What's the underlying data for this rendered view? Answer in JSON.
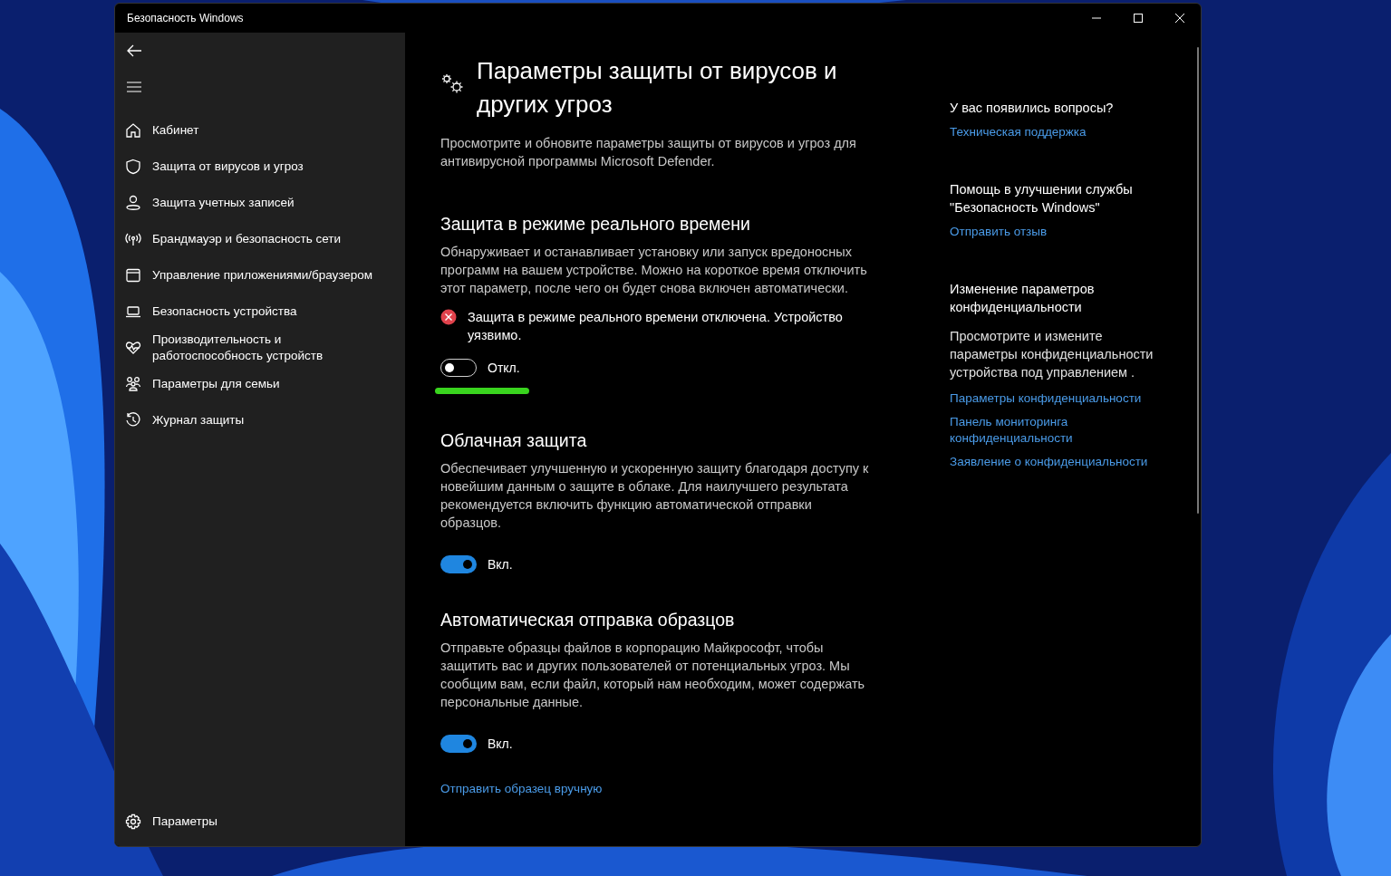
{
  "window": {
    "title": "Безопасность Windows"
  },
  "sidebar": {
    "items": [
      {
        "label": "Кабинет"
      },
      {
        "label": "Защита от вирусов и угроз"
      },
      {
        "label": "Защита учетных записей"
      },
      {
        "label": "Брандмауэр и безопасность сети"
      },
      {
        "label": "Управление приложениями/браузером"
      },
      {
        "label": "Безопасность устройства"
      },
      {
        "label": "Производительность и работоспособность устройств"
      },
      {
        "label": "Параметры для семьи"
      },
      {
        "label": "Журнал защиты"
      }
    ],
    "settings": "Параметры"
  },
  "main": {
    "title": "Параметры защиты от вирусов и других угроз",
    "description": "Просмотрите и обновите параметры защиты от вирусов и угроз для антивирусной программы Microsoft Defender.",
    "sections": [
      {
        "heading": "Защита в режиме реального времени",
        "text": "Обнаруживает и останавливает установку или запуск вредоносных программ на вашем устройстве. Можно на короткое время отключить этот параметр, после чего он будет снова включен автоматически.",
        "alert": "Защита в режиме реального времени отключена. Устройство уязвимо.",
        "toggle": {
          "on": false,
          "label": "Откл."
        },
        "highlighted": true
      },
      {
        "heading": "Облачная защита",
        "text": "Обеспечивает улучшенную и ускоренную защиту благодаря доступу к новейшим данным о защите в облаке. Для наилучшего результата рекомендуется включить функцию автоматической отправки образцов.",
        "toggle": {
          "on": true,
          "label": "Вкл."
        },
        "highlighted": false
      },
      {
        "heading": "Автоматическая отправка образцов",
        "text": "Отправьте образцы файлов в корпорацию Майкрософт, чтобы защитить вас и других пользователей от потенциальных угроз. Мы сообщим вам, если файл, который нам необходим, может содержать персональные данные.",
        "toggle": {
          "on": true,
          "label": "Вкл."
        },
        "highlighted": false,
        "link": "Отправить образец вручную"
      }
    ]
  },
  "aside": [
    {
      "heading": "У вас появились вопросы?",
      "links": [
        "Техническая поддержка"
      ]
    },
    {
      "heading": "Помощь в улучшении службы \"Безопасность Windows\"",
      "links": [
        "Отправить отзыв"
      ]
    },
    {
      "heading": "Изменение параметров конфиденциальности",
      "text": "Просмотрите и измените параметры конфиденциальности устройства под управлением .",
      "links": [
        "Параметры конфиденциальности",
        "Панель мониторинга конфиденциальности",
        "Заявление о конфиденциальности"
      ]
    }
  ]
}
